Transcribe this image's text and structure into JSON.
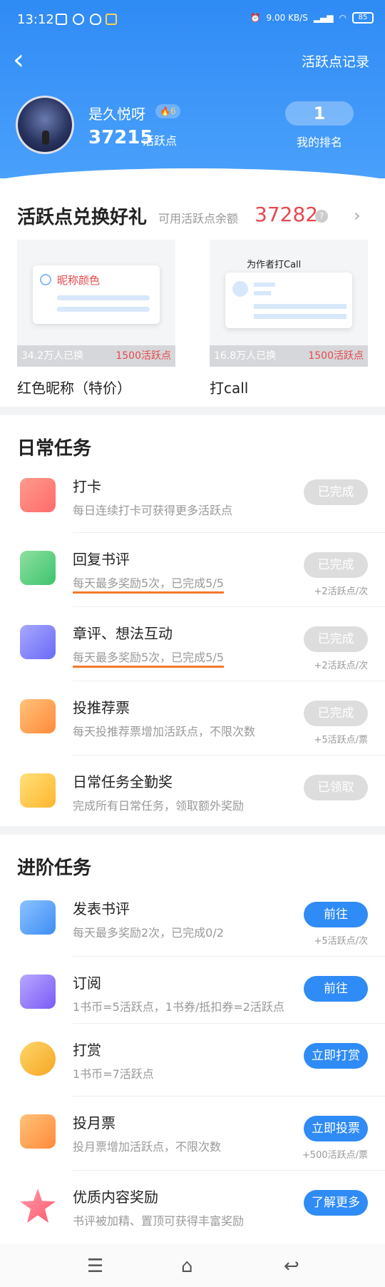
{
  "status": {
    "time": "13:12",
    "net": "9.00 KB/S",
    "battery": "85"
  },
  "header": {
    "title_link": "活跃点记录",
    "username": "是久悦呀",
    "level": "6",
    "points": "37215",
    "points_label": "活跃点",
    "rank": "1",
    "rank_label": "我的排名",
    "primary_color": "#2f8bf5"
  },
  "exchange": {
    "title": "活跃点兑换好礼",
    "balance_label": "可用活跃点余额",
    "balance": "37282",
    "help": "?",
    "gifts": [
      {
        "card_text": "昵称颜色",
        "count": "34.2万人已换",
        "price": "1500活跃点",
        "name": "红色昵称（特价）"
      },
      {
        "card_text": "为作者打Call",
        "count": "16.8万人已换",
        "price": "1500活跃点",
        "name": "打call"
      }
    ]
  },
  "daily": {
    "title": "日常任务",
    "tasks": [
      {
        "name": "打卡",
        "desc": "每日连续打卡可获得更多活跃点",
        "btn": "已完成",
        "reward": ""
      },
      {
        "name": "回复书评",
        "desc": "每天最多奖励5次，已完成5/5",
        "btn": "已完成",
        "reward": "+2活跃点/次"
      },
      {
        "name": "章评、想法互动",
        "desc": "每天最多奖励5次，已完成5/5",
        "btn": "已完成",
        "reward": "+2活跃点/次"
      },
      {
        "name": "投推荐票",
        "desc": "每天投推荐票增加活跃点，不限次数",
        "btn": "已完成",
        "reward": "+5活跃点/票"
      },
      {
        "name": "日常任务全勤奖",
        "desc": "完成所有日常任务，领取额外奖励",
        "btn": "已领取",
        "reward": ""
      }
    ]
  },
  "advanced": {
    "title": "进阶任务",
    "tasks": [
      {
        "name": "发表书评",
        "desc": "每天最多奖励2次，已完成0/2",
        "btn": "前往",
        "reward": "+5活跃点/次"
      },
      {
        "name": "订阅",
        "desc": "1书币=5活跃点，1书券/抵扣券=2活跃点",
        "btn": "前往",
        "reward": ""
      },
      {
        "name": "打赏",
        "desc": "1书币=7活跃点",
        "btn": "立即打赏",
        "reward": ""
      },
      {
        "name": "投月票",
        "desc": "投月票增加活跃点，不限次数",
        "btn": "立即投票",
        "reward": "+500活跃点/票"
      },
      {
        "name": "优质内容奖励",
        "desc": "书评被加精、置顶可获得丰富奖励",
        "btn": "了解更多",
        "reward": ""
      }
    ]
  },
  "nav": {
    "menu": "☰",
    "home": "⌂",
    "back": "↩"
  }
}
